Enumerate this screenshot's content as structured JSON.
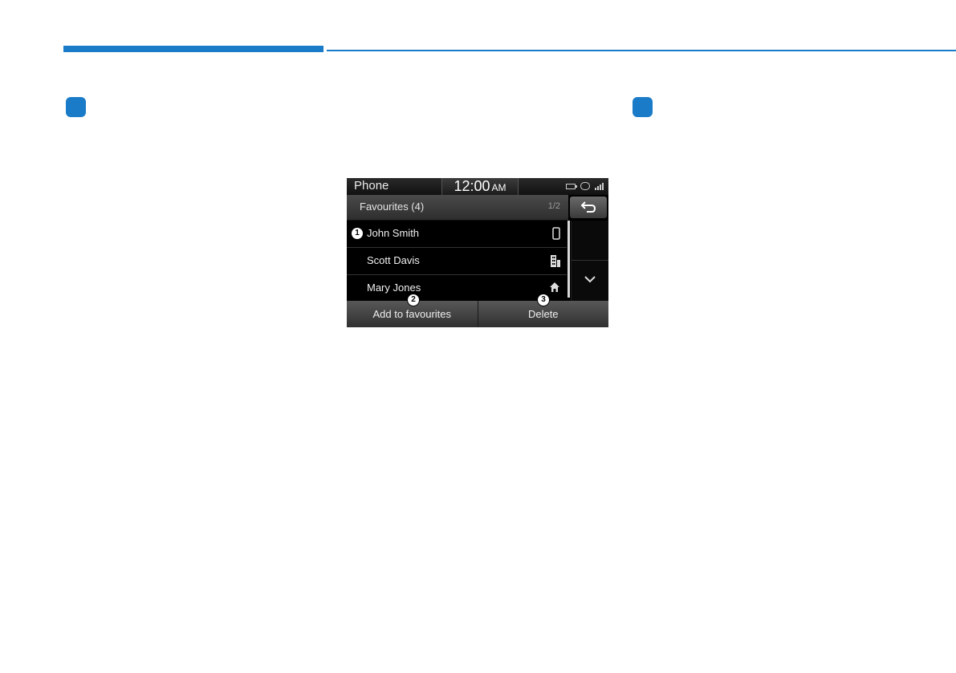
{
  "colors": {
    "accent": "#1a7bc8"
  },
  "status_bar": {
    "app_title": "Phone",
    "time": "12:00",
    "ampm": "AM",
    "icons": [
      "battery-icon",
      "bluetooth-icon",
      "signal-icon"
    ]
  },
  "header": {
    "title": "Favourites (4)",
    "page": "1/2",
    "back_icon": "back-arrow-icon"
  },
  "favourites": [
    {
      "name": "John Smith",
      "icon": "mobile-phone-icon",
      "callout": "1"
    },
    {
      "name": "Scott Davis",
      "icon": "office-phone-icon"
    },
    {
      "name": "Mary Jones",
      "icon": "home-phone-icon"
    }
  ],
  "bottom_buttons": {
    "add": {
      "label": "Add to favourites",
      "callout": "2"
    },
    "delete": {
      "label": "Delete",
      "callout": "3"
    }
  },
  "scroll": {
    "down_icon": "chevron-down-icon"
  }
}
